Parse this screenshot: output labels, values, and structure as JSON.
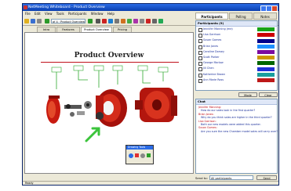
{
  "window": {
    "title": "NetMeeting Whiteboard - Product Overview"
  },
  "menu": [
    "File",
    "Edit",
    "View",
    "Tools",
    "Participants",
    "Window",
    "Help"
  ],
  "toolbar": {
    "page_value": "of 4 · Product Overview"
  },
  "doc_tabs": [
    "Intro",
    "Features",
    "Product Overview",
    "Pricing"
  ],
  "slide": {
    "title": "Product Overview"
  },
  "right_tabs": [
    "Participants",
    "Polling",
    "Notes"
  ],
  "participants": {
    "header": "Participants (9)",
    "rows": [
      {
        "name": "Jennifer Manning (me)",
        "color": "#17a317"
      },
      {
        "name": "Lisa Garrison",
        "color": "#cc0000"
      },
      {
        "name": "Susan Gomes",
        "color": "#00008b"
      },
      {
        "name": "Brian Jones",
        "color": "#1e90ff"
      },
      {
        "name": "Caroline Dorsey",
        "color": "#7b0aa0"
      },
      {
        "name": "Scott Parker",
        "color": "#cc9900"
      },
      {
        "name": "George Marlow",
        "color": "#006400"
      },
      {
        "name": "Jill Chen",
        "color": "#1f2fd6"
      },
      {
        "name": "Katherine Brown",
        "color": "#1a9e9e"
      },
      {
        "name": "Ann Marie Ross",
        "color": "#bd1818"
      }
    ]
  },
  "buttons": {
    "mode": "Mode",
    "clear": "Clear",
    "send": "Send"
  },
  "chat": {
    "header": "Chat",
    "lines": [
      {
        "who": "Jennifer Manning:",
        "msg": "How do our sales look in the first quarter?"
      },
      {
        "who": "Brian Jones:",
        "msg": "Why do you think sales are higher in the third quarter?"
      },
      {
        "who": "Lisa Garrison:",
        "msg": "Both our new models were added this quarter."
      },
      {
        "who": "Susan Gomes:",
        "msg": "Are you sure the new Chamber model sales will carry over?"
      }
    ]
  },
  "send_to": {
    "label": "Send to:",
    "value": "All participants"
  },
  "status": "Ready",
  "drawtools": {
    "title": "Drawing Tools"
  }
}
